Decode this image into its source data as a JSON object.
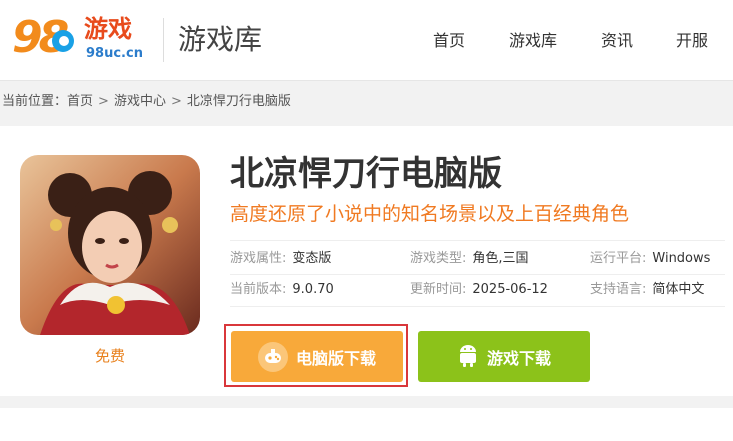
{
  "header": {
    "logo_text": "98",
    "logo_cn": "游戏",
    "logo_url": "98uc.cn",
    "site_title": "游戏库",
    "nav": [
      "首页",
      "游戏库",
      "资讯",
      "开服"
    ]
  },
  "breadcrumb": {
    "label": "当前位置：",
    "items": [
      "首页",
      "游戏中心",
      "北凉悍刀行电脑版"
    ],
    "separator": ">"
  },
  "game": {
    "title": "北凉悍刀行电脑版",
    "description": "高度还原了小说中的知名场景以及上百经典角色",
    "price": "免费",
    "info": [
      {
        "key": "游戏属性:",
        "value": "变态版"
      },
      {
        "key": "游戏类型:",
        "value": "角色,三国"
      },
      {
        "key": "运行平台:",
        "value": "Windows"
      },
      {
        "key": "当前版本:",
        "value": "9.0.70"
      },
      {
        "key": "更新时间:",
        "value": "2025-06-12"
      },
      {
        "key": "支持语言:",
        "value": "简体中文"
      }
    ]
  },
  "buttons": {
    "pc_download": "电脑版下载",
    "game_download": "游戏下载"
  },
  "colors": {
    "accent_orange": "#f8a93a",
    "accent_green": "#8cc21a",
    "desc_orange": "#f07a22",
    "highlight_red": "#d9373b"
  }
}
